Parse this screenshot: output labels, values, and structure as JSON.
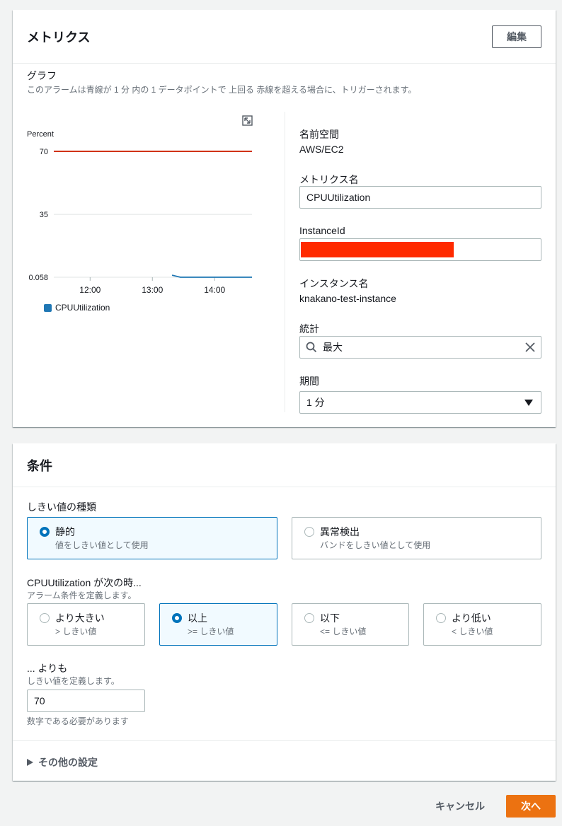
{
  "metrics": {
    "title": "メトリクス",
    "edit_label": "編集",
    "graph_label": "グラフ",
    "graph_desc": "このアラームは青線が 1 分 内の 1 データポイントで 上回る 赤線を超える場合に、トリガーされます。",
    "namespace_label": "名前空間",
    "namespace_value": "AWS/EC2",
    "metric_name_label": "メトリクス名",
    "metric_name_value": "CPUUtilization",
    "instance_id_label": "InstanceId",
    "instance_name_label": "インスタンス名",
    "instance_name_value": "knakano-test-instance",
    "statistic_label": "統計",
    "statistic_value": "最大",
    "period_label": "期間",
    "period_value": "1 分"
  },
  "chart_data": {
    "type": "line",
    "ylabel": "Percent",
    "y_ticks": [
      "70",
      "35",
      "0.058"
    ],
    "ylim": [
      0.058,
      70
    ],
    "x_ticks": [
      "12:00",
      "13:00",
      "14:00"
    ],
    "threshold": 70,
    "threshold_color": "#d13212",
    "series": [
      {
        "name": "CPUUtilization",
        "color": "#1f77b4",
        "x": [
          "13:19",
          "13:27",
          "14:36"
        ],
        "values": [
          1.2,
          0.058,
          0.058
        ]
      }
    ]
  },
  "conditions": {
    "title": "条件",
    "threshold_type_label": "しきい値の種類",
    "static_title": "静的",
    "static_desc": "値をしきい値として使用",
    "anomaly_title": "異常検出",
    "anomaly_desc": "バンドをしきい値として使用",
    "when_label": "CPUUtilization が次の時...",
    "when_desc": "アラーム条件を定義します。",
    "ops": [
      {
        "title": "より大きい",
        "desc": "> しきい値"
      },
      {
        "title": "以上",
        "desc": ">= しきい値"
      },
      {
        "title": "以下",
        "desc": "<= しきい値"
      },
      {
        "title": "より低い",
        "desc": "< しきい値"
      }
    ],
    "than_label": "... よりも",
    "than_desc": "しきい値を定義します。",
    "threshold_value": "70",
    "threshold_hint": "数字である必要があります",
    "additional_settings": "その他の設定"
  },
  "footer": {
    "cancel_label": "キャンセル",
    "next_label": "次へ"
  },
  "colors": {
    "accent": "#0073bb",
    "primary_button": "#ec7211",
    "redacted": "#ff2a00"
  },
  "icons": [
    "expand-icon",
    "search-icon",
    "clear-icon",
    "caret-down-icon",
    "legend-swatch-icon",
    "triangle-right-icon"
  ]
}
